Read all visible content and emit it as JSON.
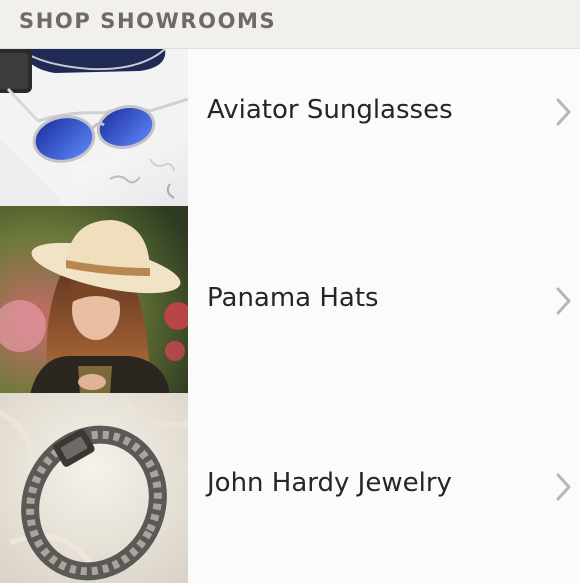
{
  "header": {
    "title": "SHOP SHOWROOMS"
  },
  "showrooms": [
    {
      "label": "Aviator Sunglasses",
      "image_icon": "aviator-sunglasses-photo"
    },
    {
      "label": "Panama Hats",
      "image_icon": "panama-hat-photo"
    },
    {
      "label": "John Hardy Jewelry",
      "image_icon": "john-hardy-bracelet-photo"
    }
  ],
  "colors": {
    "header_bg": "#f2f0ec",
    "header_text": "#6f6a69",
    "row_bg": "#fcfbfc",
    "label_text": "#2a2525",
    "chevron": "#b9b5b5",
    "divider": "#d9d6d6"
  }
}
